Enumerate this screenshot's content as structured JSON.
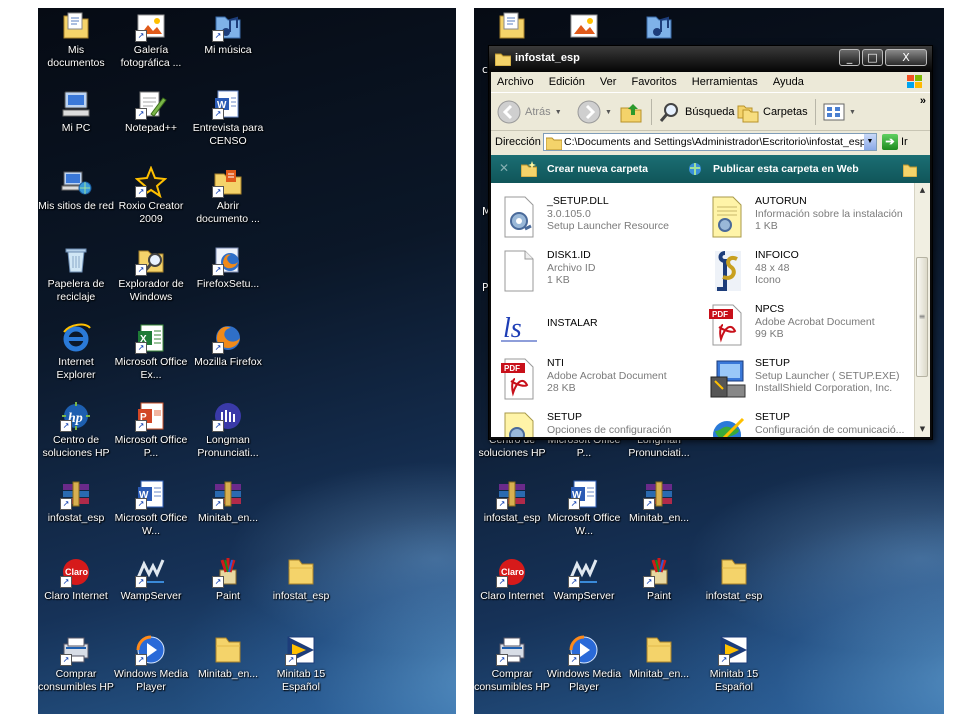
{
  "left_desktop": {
    "icons": [
      {
        "label": "Mis documentos",
        "icon": "my-documents-icon"
      },
      {
        "label": "Galería fotográfica ...",
        "icon": "photo-gallery-icon"
      },
      {
        "label": "Mi música",
        "icon": "my-music-icon"
      },
      {
        "label": "Mi PC",
        "icon": "my-computer-icon"
      },
      {
        "label": "Notepad++",
        "icon": "notepad-plus-plus-icon"
      },
      {
        "label": "Entrevista para CENSO",
        "icon": "word-document-icon"
      },
      {
        "label": "Mis sitios de red",
        "icon": "network-places-icon"
      },
      {
        "label": "Roxio Creator 2009",
        "icon": "roxio-star-icon"
      },
      {
        "label": "Abrir documento ...",
        "icon": "open-document-icon"
      },
      {
        "label": "Papelera de reciclaje",
        "icon": "recycle-bin-icon"
      },
      {
        "label": "Explorador de Windows",
        "icon": "windows-explorer-icon"
      },
      {
        "label": "FirefoxSetu...",
        "icon": "firefox-setup-icon"
      },
      {
        "label": "Internet Explorer",
        "icon": "internet-explorer-icon"
      },
      {
        "label": "Microsoft Office Ex...",
        "icon": "excel-icon"
      },
      {
        "label": "Mozilla Firefox",
        "icon": "firefox-icon"
      },
      {
        "label": "Centro de soluciones HP",
        "icon": "hp-solution-center-icon"
      },
      {
        "label": "Microsoft Office P...",
        "icon": "powerpoint-icon"
      },
      {
        "label": "Longman Pronunciati...",
        "icon": "longman-icon"
      },
      {
        "label": "infostat_esp",
        "icon": "winrar-archive-icon"
      },
      {
        "label": "Microsoft Office W...",
        "icon": "word-icon"
      },
      {
        "label": "Minitab_en...",
        "icon": "winrar-archive-icon"
      },
      {
        "label": "Claro Internet",
        "icon": "claro-icon"
      },
      {
        "label": "WampServer",
        "icon": "wampserver-icon"
      },
      {
        "label": "Paint",
        "icon": "paint-icon"
      },
      {
        "label": "infostat_esp",
        "icon": "folder-icon"
      },
      {
        "label": "Comprar consumibles HP",
        "icon": "hp-supplies-icon"
      },
      {
        "label": "Windows Media Player",
        "icon": "media-player-icon"
      },
      {
        "label": "Minitab_en...",
        "icon": "folder-icon"
      },
      {
        "label": "Minitab 15 Español",
        "icon": "minitab-icon"
      }
    ]
  },
  "right_desktop": {
    "partial_labels": [
      "c",
      "M",
      "P"
    ],
    "icons": [
      {
        "label": "Centro de soluciones HP",
        "icon": "hp-solution-center-icon"
      },
      {
        "label": "Microsoft Office P...",
        "icon": "powerpoint-icon"
      },
      {
        "label": "Longman Pronunciati...",
        "icon": "longman-icon"
      },
      {
        "label": "infostat_esp",
        "icon": "winrar-archive-icon"
      },
      {
        "label": "Microsoft Office W...",
        "icon": "word-icon"
      },
      {
        "label": "Minitab_en...",
        "icon": "winrar-archive-icon"
      },
      {
        "label": "Claro Internet",
        "icon": "claro-icon"
      },
      {
        "label": "WampServer",
        "icon": "wampserver-icon"
      },
      {
        "label": "Paint",
        "icon": "paint-icon"
      },
      {
        "label": "infostat_esp",
        "icon": "folder-icon"
      },
      {
        "label": "Comprar consumibles HP",
        "icon": "hp-supplies-icon"
      },
      {
        "label": "Windows Media Player",
        "icon": "media-player-icon"
      },
      {
        "label": "Minitab_en...",
        "icon": "folder-icon"
      },
      {
        "label": "Minitab 15 Español",
        "icon": "minitab-icon"
      }
    ]
  },
  "window": {
    "title": "infostat_esp",
    "controls": {
      "minimize": "_",
      "maximize": "□",
      "close": "X"
    },
    "menu": [
      "Archivo",
      "Edición",
      "Ver",
      "Favoritos",
      "Herramientas",
      "Ayuda"
    ],
    "toolbar": {
      "back": "Atrás",
      "search": "Búsqueda",
      "folders": "Carpetas",
      "overflow": "»"
    },
    "address": {
      "label": "Dirección",
      "value": "C:\\Documents and Settings\\Administrador\\Escritorio\\infostat_esp",
      "go": "Ir"
    },
    "tasks": {
      "new_folder": "Crear nueva carpeta",
      "publish": "Publicar esta carpeta en Web"
    },
    "files": [
      {
        "name": "_SETUP.DLL",
        "line1": "3.0.105.0",
        "line2": "Setup Launcher Resource",
        "icon": "dll-gear-icon"
      },
      {
        "name": "AUTORUN",
        "line1": "Información sobre la instalación",
        "line2": "1 KB",
        "icon": "notepad-setup-icon"
      },
      {
        "name": "DISK1.ID",
        "line1": "Archivo ID",
        "line2": "1 KB",
        "icon": "blank-file-icon"
      },
      {
        "name": "INFOICO",
        "line1": "48 x 48",
        "line2": "Icono",
        "icon": "infostat-logo-icon"
      },
      {
        "name": "INSTALAR",
        "line1": "",
        "line2": "",
        "icon": "infostat-ls-icon"
      },
      {
        "name": "NPCS",
        "line1": "Adobe Acrobat Document",
        "line2": "99 KB",
        "icon": "pdf-icon"
      },
      {
        "name": "NTI",
        "line1": "Adobe Acrobat Document",
        "line2": "28 KB",
        "icon": "pdf-icon"
      },
      {
        "name": "SETUP",
        "line1": "Setup Launcher ( SETUP.EXE)",
        "line2": "InstallShield Corporation, Inc.",
        "icon": "installshield-icon"
      },
      {
        "name": "SETUP",
        "line1": "Opciones de configuración",
        "line2": "",
        "icon": "setup-config-icon"
      },
      {
        "name": "SETUP",
        "line1": "Configuración de comunicació...",
        "line2": "",
        "icon": "setup-globe-icon"
      }
    ],
    "scroll_thumb_glyph": "≡"
  },
  "colors": {
    "desktop_dark": "#0b1728",
    "task_pane": "#1b6e73",
    "window_frame": "#0a0a0a",
    "chrome": "#ece9d8"
  }
}
